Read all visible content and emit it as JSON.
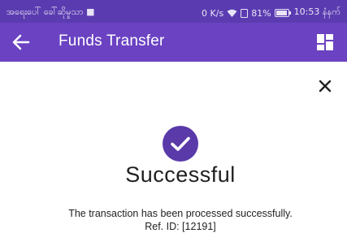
{
  "status_bar": {
    "carrier": "အရေးပေါ် ခေါ်ဆိုမှုသာ",
    "speed": "0 K/s",
    "battery": "81%",
    "time": "10:53 နံနက်",
    "icons": [
      "notification-icon",
      "wifi-icon",
      "sim-icon",
      "battery-icon"
    ]
  },
  "app_bar": {
    "title": "Funds Transfer",
    "back_icon": "arrow-left-icon",
    "menu_icon": "dashboard-icon"
  },
  "dialog": {
    "close_icon": "close-icon",
    "status_icon": "check-circle-icon",
    "status": "Successful",
    "message": "The transaction has been processed successfully.",
    "reference": "Ref. ID: [12191]"
  },
  "colors": {
    "status_bar": "#5b3cb0",
    "app_bar": "#6a42c2",
    "accent": "#5a3aa8",
    "text": "#1f1f1f"
  }
}
